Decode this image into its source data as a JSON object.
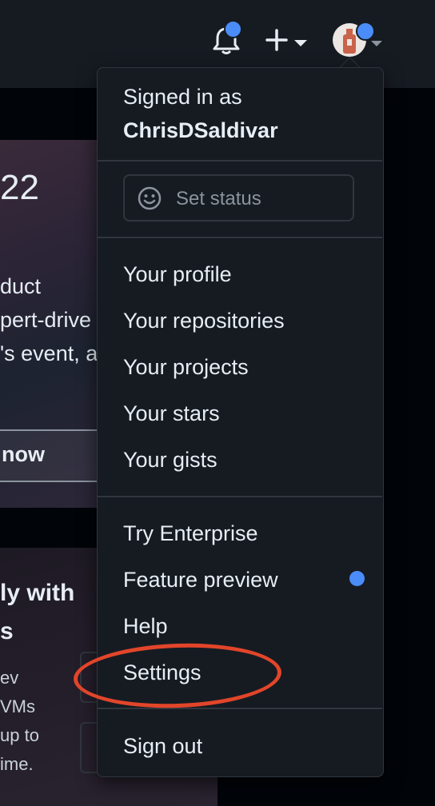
{
  "header": {
    "icons": [
      "bell-icon",
      "plus-icon",
      "caret-down-icon",
      "avatar",
      "caret-down-icon"
    ],
    "notification_dot_color": "#4b8df8"
  },
  "background": {
    "card1": {
      "title_fragment": "22",
      "body_lines": [
        "duct",
        "pert-drive",
        "'s event, a"
      ],
      "button_fragment": "now"
    },
    "card2": {
      "title_lines": [
        "ly with",
        "s"
      ],
      "body_lines": [
        "ev",
        "VMs",
        "up to",
        "ime."
      ]
    }
  },
  "menu": {
    "signed_in_label": "Signed in as",
    "username": "ChrisDSaldivar",
    "set_status_placeholder": "Set status",
    "profile_items": [
      "Your profile",
      "Your repositories",
      "Your projects",
      "Your stars",
      "Your gists"
    ],
    "extra_items": [
      "Try Enterprise",
      "Feature preview",
      "Help",
      "Settings"
    ],
    "sign_out": "Sign out",
    "feature_preview_dot_color": "#4b8df8"
  },
  "annotation": {
    "highlight_target": "Settings",
    "highlight_color": "#e2452a"
  }
}
